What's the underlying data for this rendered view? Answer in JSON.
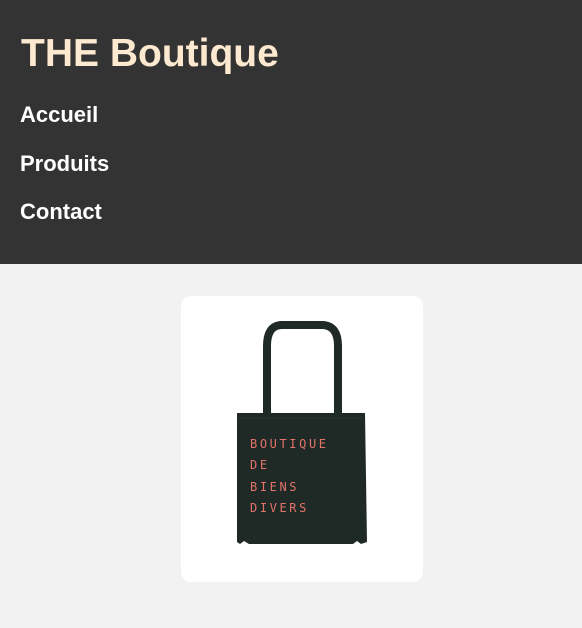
{
  "header": {
    "title": "THE Boutique",
    "nav": [
      {
        "label": "Accueil"
      },
      {
        "label": "Produits"
      },
      {
        "label": "Contact"
      }
    ]
  },
  "product": {
    "image_label": "tote-bag",
    "bag_print": [
      "BOUTIQUE",
      "DE",
      "BIENS",
      "DIVERS"
    ]
  },
  "colors": {
    "header_bg": "#333333",
    "title": "#fde9cf",
    "nav_text": "#ffffff",
    "page_bg": "#f2f2f2",
    "card_bg": "#ffffff",
    "bag": "#1f2a27",
    "bag_print": "#e4736a"
  }
}
